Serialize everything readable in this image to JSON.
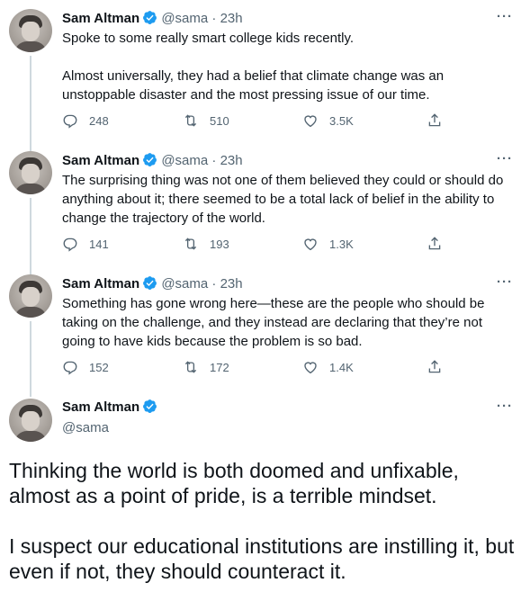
{
  "author": {
    "name": "Sam Altman",
    "handle": "@sama"
  },
  "tweets": [
    {
      "time": "23h",
      "text": "Spoke to some really smart college kids recently.\n\nAlmost universally, they had a belief that climate change was an unstoppable disaster and the most pressing issue of our time.",
      "replies": "248",
      "retweets": "510",
      "likes": "3.5K"
    },
    {
      "time": "23h",
      "text": "The surprising thing was not one of them believed they could or should do anything about it; there seemed to be a total lack of belief in the ability to change the trajectory of the world.",
      "replies": "141",
      "retweets": "193",
      "likes": "1.3K"
    },
    {
      "time": "23h",
      "text": "Something has gone wrong here—these are the people who should be taking on the challenge, and they instead are declaring that they’re not going to have kids because the problem is so bad.",
      "replies": "152",
      "retweets": "172",
      "likes": "1.4K"
    }
  ],
  "focus_tweet": {
    "text": "Thinking the world is both doomed and unfixable, almost as a point of pride, is a terrible mindset.\n\nI suspect our educational institutions are instilling it, but even if not, they should counteract it."
  },
  "ui": {
    "dot": "·",
    "more": "···"
  },
  "colors": {
    "verified": "#1d9bf0",
    "secondary_text": "#536471",
    "thread_line": "#cfd9de"
  }
}
